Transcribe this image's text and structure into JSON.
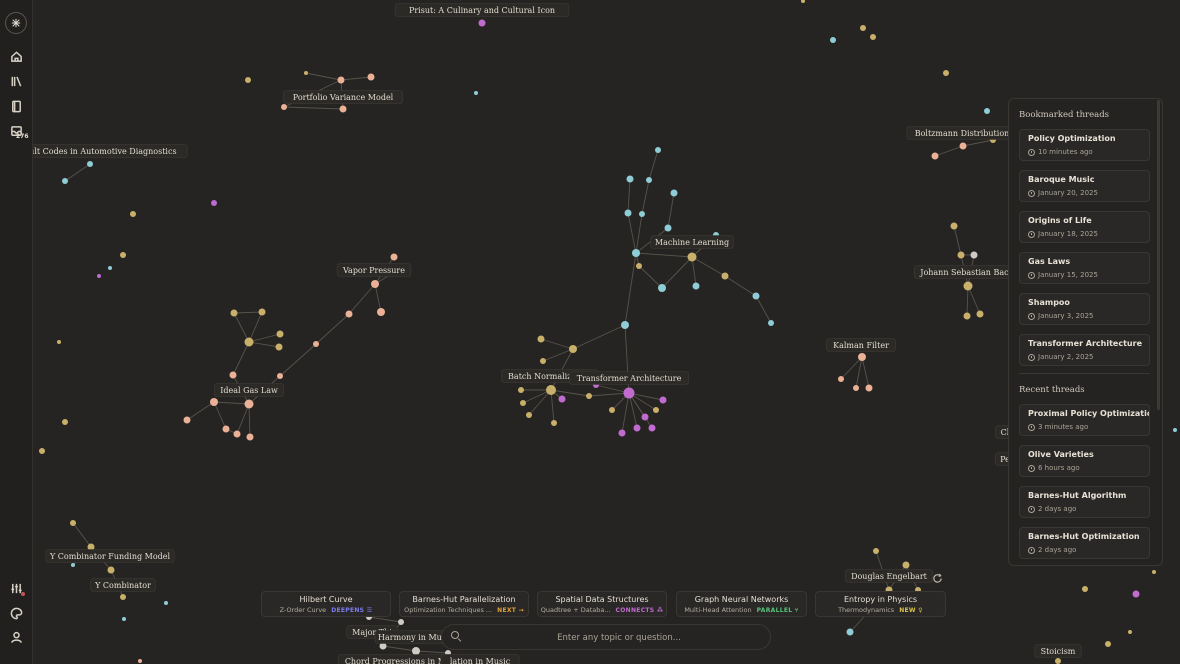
{
  "sidebar": {
    "logo_icon": "app-logo-icon",
    "items": [
      {
        "name": "home",
        "icon": "home-icon"
      },
      {
        "name": "library",
        "icon": "library-icon"
      },
      {
        "name": "notebook",
        "icon": "notebook-icon"
      },
      {
        "name": "inbox",
        "icon": "inbox-icon",
        "badge": "276"
      }
    ],
    "bottom_items": [
      {
        "name": "settings",
        "icon": "sliders-icon"
      },
      {
        "name": "theme",
        "icon": "palette-icon"
      },
      {
        "name": "profile",
        "icon": "user-icon"
      }
    ]
  },
  "graph": {
    "colors": {
      "tan": "#c9b06a",
      "peach": "#eab197",
      "teal": "#8fcdd6",
      "purple": "#c06bcf",
      "gray": "#cfcbc4"
    },
    "labels": {
      "prisut": "Prisut: A Culinary and Cultural Icon",
      "portfolio": "Portfolio Variance Model",
      "fault_codes": "Fault Codes in Automotive Diagnostics",
      "boltzmann": "Boltzmann Distribution",
      "machine_learning": "Machine Learning",
      "vapor_pressure": "Vapor Pressure",
      "js_bach": "Johann Sebastian Bach",
      "kalman": "Kalman Filter",
      "ideal_gas": "Ideal Gas Law",
      "batch_norm": "Batch Normalization",
      "transformer": "Transformer Architecture",
      "yc_funding": "Y Combinator Funding Model",
      "yc": "Y Combinator",
      "douglas": "Douglas Engelbart",
      "major": "Major Thi",
      "harmony": "Harmony in Mus",
      "chord": "Chord Progressions in Mus",
      "chord2": "lation in Music",
      "stoicism": "Stoicism",
      "ch": "Cl",
      "pe": "Pe"
    }
  },
  "panel": {
    "bookmarked_title": "Bookmarked threads",
    "bookmarked": [
      {
        "title": "Policy Optimization",
        "time": "10 minutes ago"
      },
      {
        "title": "Baroque Music",
        "time": "January 20, 2025"
      },
      {
        "title": "Origins of Life",
        "time": "January 18, 2025"
      },
      {
        "title": "Gas Laws",
        "time": "January 15, 2025"
      },
      {
        "title": "Shampoo",
        "time": "January 3, 2025"
      },
      {
        "title": "Transformer Architecture",
        "time": "January 2, 2025"
      }
    ],
    "recent_title": "Recent threads",
    "recent": [
      {
        "title": "Proximal Policy Optimization",
        "time": "3 minutes ago"
      },
      {
        "title": "Olive Varieties",
        "time": "6 hours ago"
      },
      {
        "title": "Barnes-Hut Algorithm",
        "time": "2 days ago"
      },
      {
        "title": "Barnes-Hut Optimization",
        "time": "2 days ago"
      }
    ]
  },
  "suggestions": [
    {
      "title": "Hilbert Curve",
      "sub": "Z-Order Curve",
      "relation": "DEEPENS",
      "color": "#7c7cf0",
      "icon": "layers-icon"
    },
    {
      "title": "Barnes-Hut Parallelization",
      "sub": "Optimization Techniques ...",
      "relation": "NEXT",
      "color": "#e0a23c",
      "icon": "arrow-right-icon"
    },
    {
      "title": "Spatial Data Structures",
      "sub": "Quadtree + Databa...",
      "relation": "CONNECTS",
      "color": "#c06bcf",
      "icon": "nodes-icon"
    },
    {
      "title": "Graph Neural Networks",
      "sub": "Multi-Head Attention",
      "relation": "PARALLEL",
      "color": "#56c27a",
      "icon": "fork-icon"
    },
    {
      "title": "Entropy in Physics",
      "sub": "Thermodynamics",
      "relation": "NEW",
      "color": "#d8c24a",
      "icon": "bulb-icon"
    }
  ],
  "search": {
    "placeholder": "Enter any topic or question..."
  }
}
